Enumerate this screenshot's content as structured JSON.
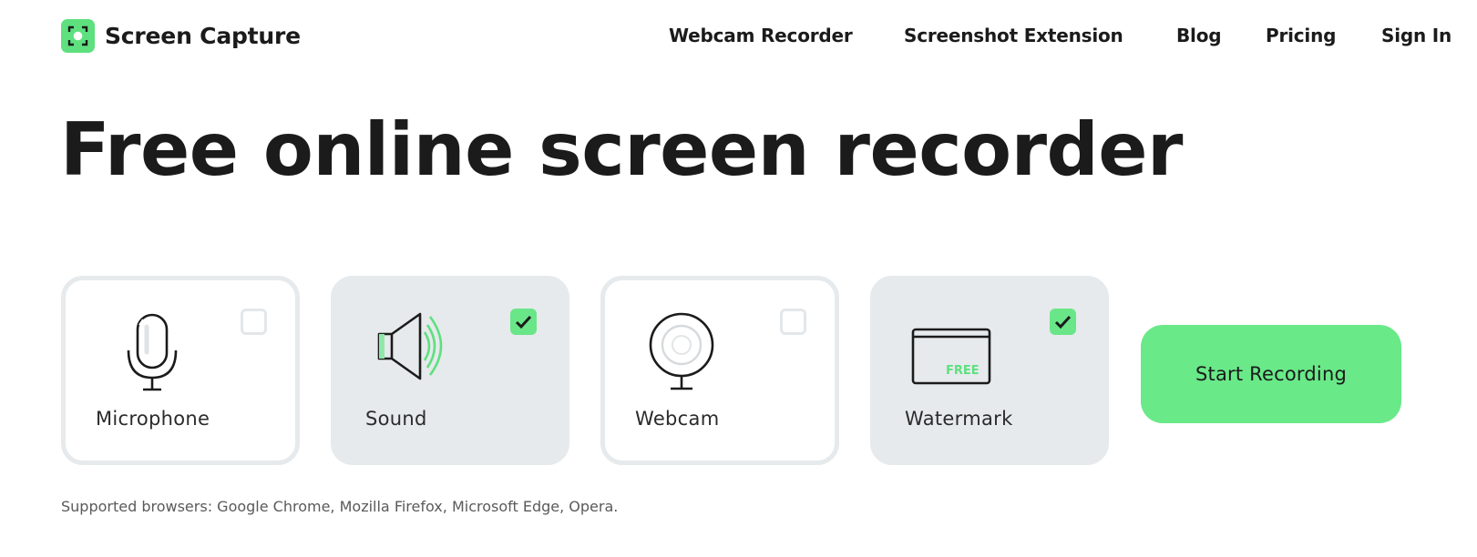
{
  "header": {
    "brand": "Screen Capture",
    "nav": [
      {
        "label": "Webcam Recorder"
      },
      {
        "label": "Screenshot Extension"
      },
      {
        "label": "Blog"
      },
      {
        "label": "Pricing"
      },
      {
        "label": "Sign In"
      }
    ]
  },
  "hero": {
    "title": "Free online screen recorder"
  },
  "options": [
    {
      "label": "Microphone",
      "checked": false,
      "icon": "microphone-icon"
    },
    {
      "label": "Sound",
      "checked": true,
      "icon": "speaker-icon"
    },
    {
      "label": "Webcam",
      "checked": false,
      "icon": "webcam-icon"
    },
    {
      "label": "Watermark",
      "checked": true,
      "icon": "watermark-icon",
      "icon_text": "FREE"
    }
  ],
  "start_button": {
    "label": "Start Recording"
  },
  "supported_browsers": "Supported browsers: Google Chrome, Mozilla Firefox, Microsoft Edge, Opera.",
  "colors": {
    "accent": "#69e988",
    "card_active": "#e6eaec",
    "text": "#1b1b1b"
  }
}
